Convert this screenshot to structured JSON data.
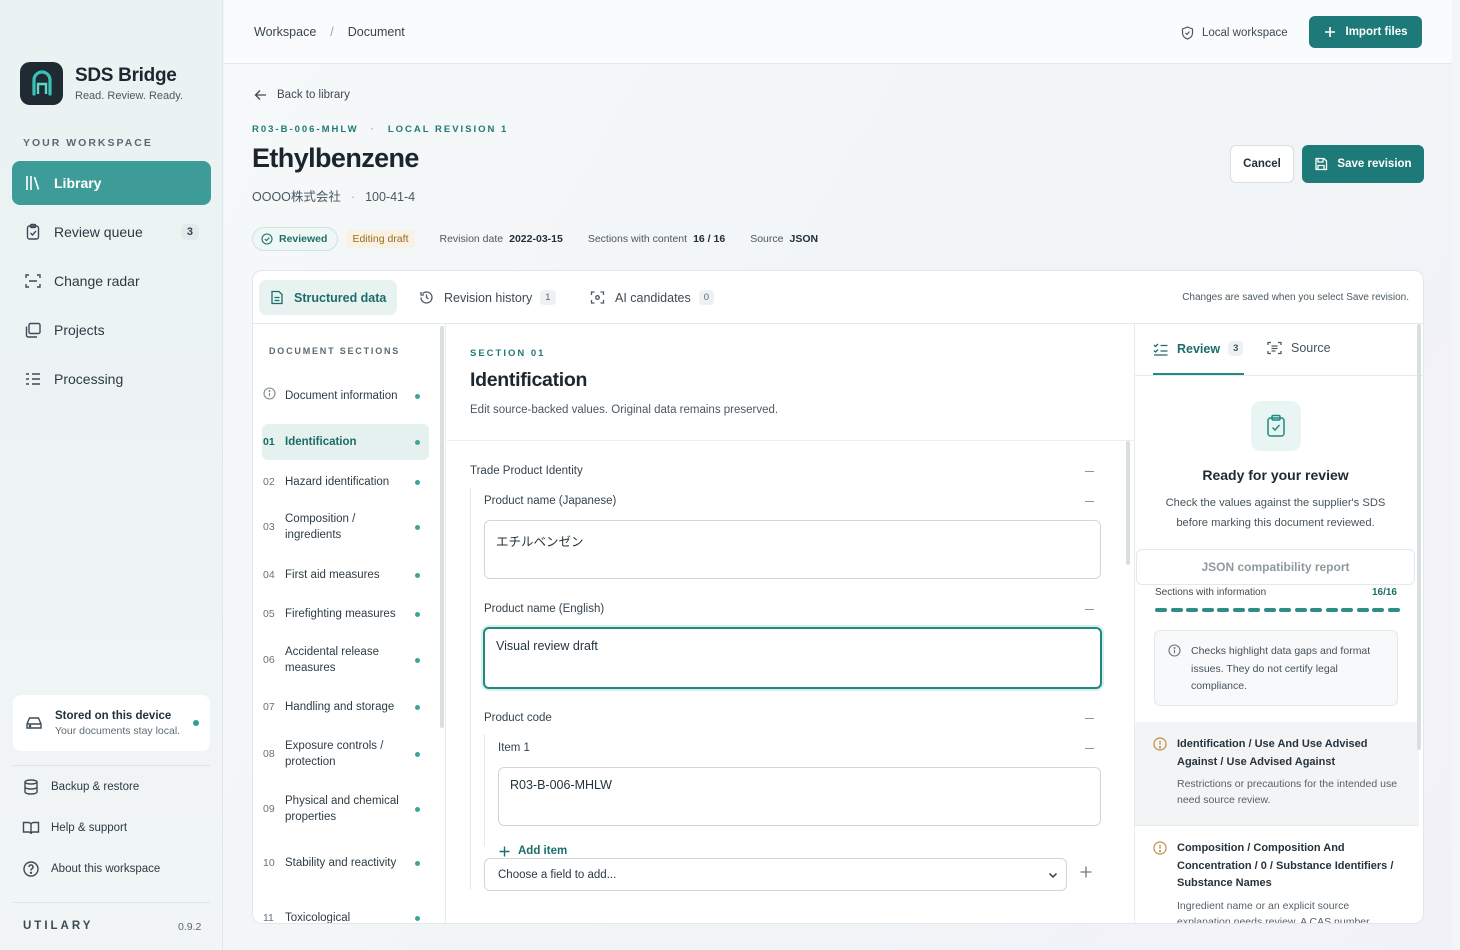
{
  "app": {
    "name": "SDS Bridge",
    "tagline": "Read. Review. Ready.",
    "workspace_label": "YOUR WORKSPACE",
    "accent": "#1d7a78"
  },
  "nav": {
    "items": [
      {
        "label": "Library",
        "icon": "library-icon",
        "active": true
      },
      {
        "label": "Review queue",
        "icon": "clipboard-icon",
        "count": "3"
      },
      {
        "label": "Change radar",
        "icon": "scan-icon"
      },
      {
        "label": "Projects",
        "icon": "folders-icon"
      },
      {
        "label": "Processing",
        "icon": "list-checks-icon"
      }
    ]
  },
  "storage": {
    "title": "Stored on this device",
    "subtitle": "Your documents stay local."
  },
  "footer": {
    "backup": "Backup & restore",
    "help": "Help & support",
    "about": "About this workspace",
    "brand": "UTILARY",
    "version": "0.9.2"
  },
  "topbar": {
    "crumbs": [
      "Workspace",
      "Document"
    ],
    "local_workspace": "Local workspace",
    "import": "Import files"
  },
  "doc": {
    "back": "Back to library",
    "code": "R03-B-006-MHLW",
    "revision": "LOCAL REVISION 1",
    "title": "Ethylbenzene",
    "company": "OOOO株式会社",
    "cas": "100-41-4",
    "cancel": "Cancel",
    "save": "Save revision",
    "status": "Reviewed",
    "draft": "Editing draft",
    "revision_date_label": "Revision date",
    "revision_date": "2022-03-15",
    "sections_label": "Sections with content",
    "sections_value": "16 / 16",
    "source_label": "Source",
    "source_value": "JSON"
  },
  "tabs": {
    "structured": "Structured data",
    "history": "Revision history",
    "history_count": "1",
    "ai": "AI candidates",
    "ai_count": "0",
    "save_note": "Changes are saved when you select Save revision."
  },
  "sections": {
    "header": "DOCUMENT SECTIONS",
    "items": [
      {
        "num": "",
        "label": "Document information"
      },
      {
        "num": "01",
        "label": "Identification",
        "active": true
      },
      {
        "num": "02",
        "label": "Hazard identification"
      },
      {
        "num": "03",
        "label": "Composition / ingredients"
      },
      {
        "num": "04",
        "label": "First aid measures"
      },
      {
        "num": "05",
        "label": "Firefighting measures"
      },
      {
        "num": "06",
        "label": "Accidental release measures"
      },
      {
        "num": "07",
        "label": "Handling and storage"
      },
      {
        "num": "08",
        "label": "Exposure controls / protection"
      },
      {
        "num": "09",
        "label": "Physical and chemical properties"
      },
      {
        "num": "10",
        "label": "Stability and reactivity"
      },
      {
        "num": "11",
        "label": "Toxicological"
      }
    ]
  },
  "form": {
    "section_label": "SECTION 01",
    "title": "Identification",
    "desc": "Edit source-backed values. Original data remains preserved.",
    "group": "Trade Product Identity",
    "name_jp_label": "Product name (Japanese)",
    "name_jp": "エチルベンゼン",
    "name_en_label": "Product name (English)",
    "name_en": "Visual review draft",
    "code_label": "Product code",
    "item_label": "Item 1",
    "item_value": "R03-B-006-MHLW",
    "add_item": "Add item",
    "choose_field": "Choose a field to add..."
  },
  "review": {
    "tab_review": "Review",
    "review_count": "3",
    "tab_source": "Source",
    "heading": "Ready for your review",
    "text": "Check the values against the supplier's SDS before marking this document reviewed.",
    "json_report": "JSON compatibility report",
    "sections_label": "Sections with information",
    "sections_value": "16/16",
    "progress": 1.0,
    "note": "Checks highlight data gaps and format issues. They do not certify legal compliance.",
    "issues": [
      {
        "title": "Identification / Use And Use Advised Against / Use Advised Against",
        "desc": "Restrictions or precautions for the intended use need source review."
      },
      {
        "title": "Composition / Composition And Concentration / 0 / Substance Identifiers / Substance Names",
        "desc": "Ingredient name or an explicit source explanation needs review. A CAS number"
      }
    ]
  }
}
